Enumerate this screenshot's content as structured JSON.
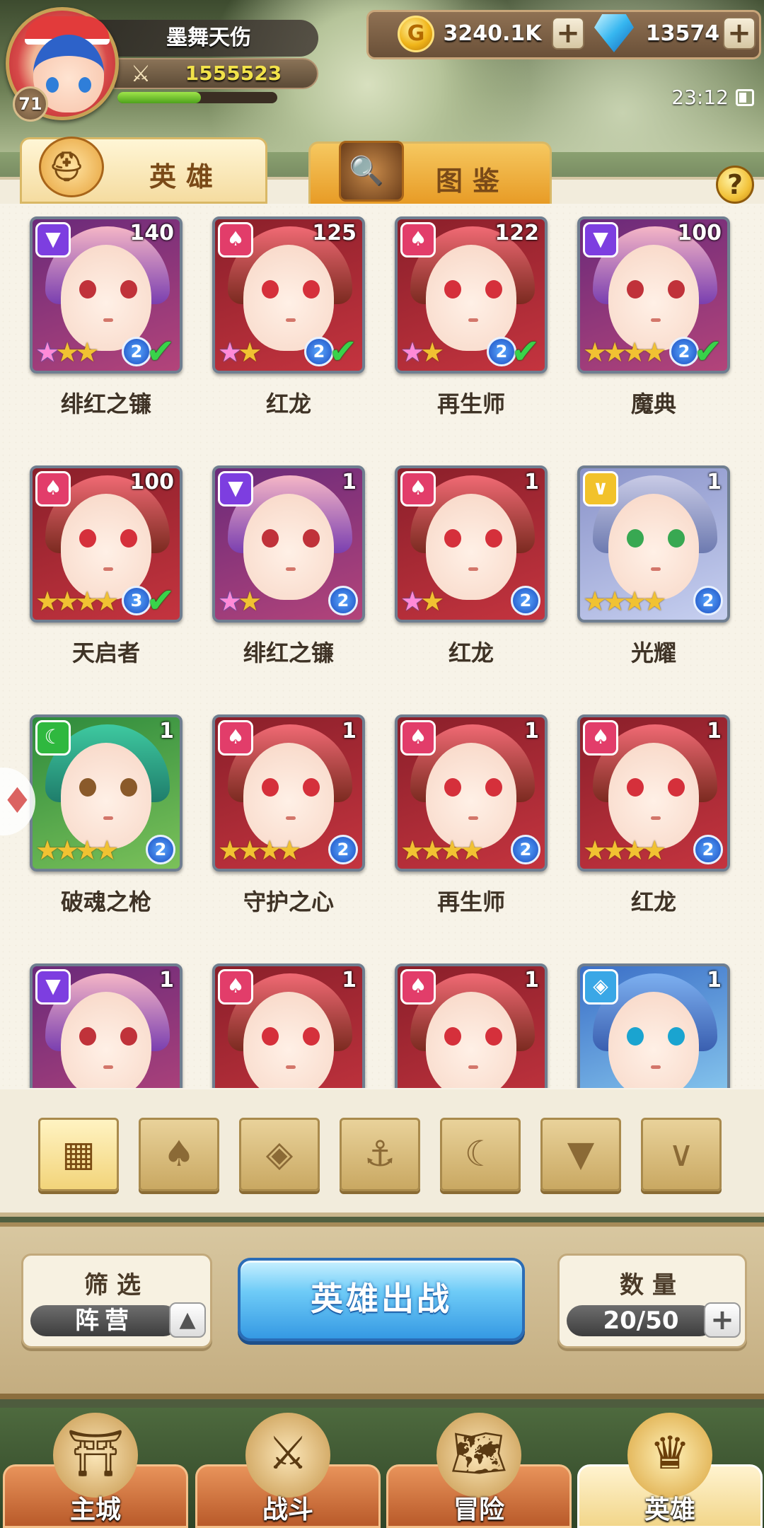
{
  "player": {
    "name": "墨舞天伤",
    "power": "1555523",
    "level": "71",
    "xp_fraction": 0.52
  },
  "resources": {
    "gold": "3240.1K",
    "gems": "13574",
    "plus": "+"
  },
  "status": {
    "time": "23:12"
  },
  "tabs": {
    "heroes": "英雄",
    "codex": "图鉴",
    "help": "?"
  },
  "icons": {
    "gold": "G",
    "tab_heroes": "⛑",
    "tab_codex": "🔍",
    "filters": [
      "▦",
      "♠",
      "◈",
      "⚓",
      "☾",
      "▼",
      "∨"
    ]
  },
  "colors": {
    "fire": "#e23d6a",
    "shadow": "#7d3ee0",
    "light": "#f2c22b",
    "nature": "#2fb83f",
    "water": "#3aa7e6",
    "deploy": "#3599e3"
  },
  "heroes": [
    {
      "name": "绯红之镰",
      "level": "140",
      "element": "shadow",
      "stars": 2,
      "rainbow": 1,
      "awaken": "2",
      "selected": true
    },
    {
      "name": "红龙",
      "level": "125",
      "element": "fire",
      "stars": 1,
      "rainbow": 1,
      "awaken": "2",
      "selected": true
    },
    {
      "name": "再生师",
      "level": "122",
      "element": "fire",
      "stars": 1,
      "rainbow": 1,
      "awaken": "2",
      "selected": true
    },
    {
      "name": "魔典",
      "level": "100",
      "element": "shadow",
      "stars": 4,
      "rainbow": 0,
      "awaken": "2",
      "selected": true
    },
    {
      "name": "天启者",
      "level": "100",
      "element": "fire",
      "stars": 4,
      "rainbow": 0,
      "awaken": "3",
      "selected": true
    },
    {
      "name": "绯红之镰",
      "level": "1",
      "element": "shadow",
      "stars": 1,
      "rainbow": 1,
      "awaken": "2",
      "selected": false
    },
    {
      "name": "红龙",
      "level": "1",
      "element": "fire",
      "stars": 1,
      "rainbow": 1,
      "awaken": "2",
      "selected": false
    },
    {
      "name": "光耀",
      "level": "1",
      "element": "light",
      "stars": 4,
      "rainbow": 0,
      "awaken": "2",
      "selected": false
    },
    {
      "name": "破魂之枪",
      "level": "1",
      "element": "nature",
      "stars": 4,
      "rainbow": 0,
      "awaken": "2",
      "selected": false
    },
    {
      "name": "守护之心",
      "level": "1",
      "element": "fire",
      "stars": 4,
      "rainbow": 0,
      "awaken": "2",
      "selected": false
    },
    {
      "name": "再生师",
      "level": "1",
      "element": "fire",
      "stars": 4,
      "rainbow": 0,
      "awaken": "2",
      "selected": false
    },
    {
      "name": "红龙",
      "level": "1",
      "element": "fire",
      "stars": 4,
      "rainbow": 0,
      "awaken": "2",
      "selected": false
    },
    {
      "name": "",
      "level": "1",
      "element": "shadow",
      "stars": 0,
      "rainbow": 0,
      "awaken": "",
      "selected": false
    },
    {
      "name": "",
      "level": "1",
      "element": "fire",
      "stars": 0,
      "rainbow": 0,
      "awaken": "",
      "selected": false
    },
    {
      "name": "",
      "level": "1",
      "element": "fire",
      "stars": 0,
      "rainbow": 0,
      "awaken": "",
      "selected": false
    },
    {
      "name": "",
      "level": "1",
      "element": "water",
      "stars": 0,
      "rainbow": 0,
      "awaken": "",
      "selected": false
    }
  ],
  "filter": {
    "title": "筛选",
    "value": "阵营",
    "toggle": "▲"
  },
  "deploy": "英雄出战",
  "count": {
    "title": "数量",
    "value": "20/50",
    "plus": "+"
  },
  "nav": [
    {
      "label": "主城",
      "icon": "⛩"
    },
    {
      "label": "战斗",
      "icon": "⚔"
    },
    {
      "label": "冒险",
      "icon": "🗺"
    },
    {
      "label": "英雄",
      "icon": "♛"
    }
  ]
}
